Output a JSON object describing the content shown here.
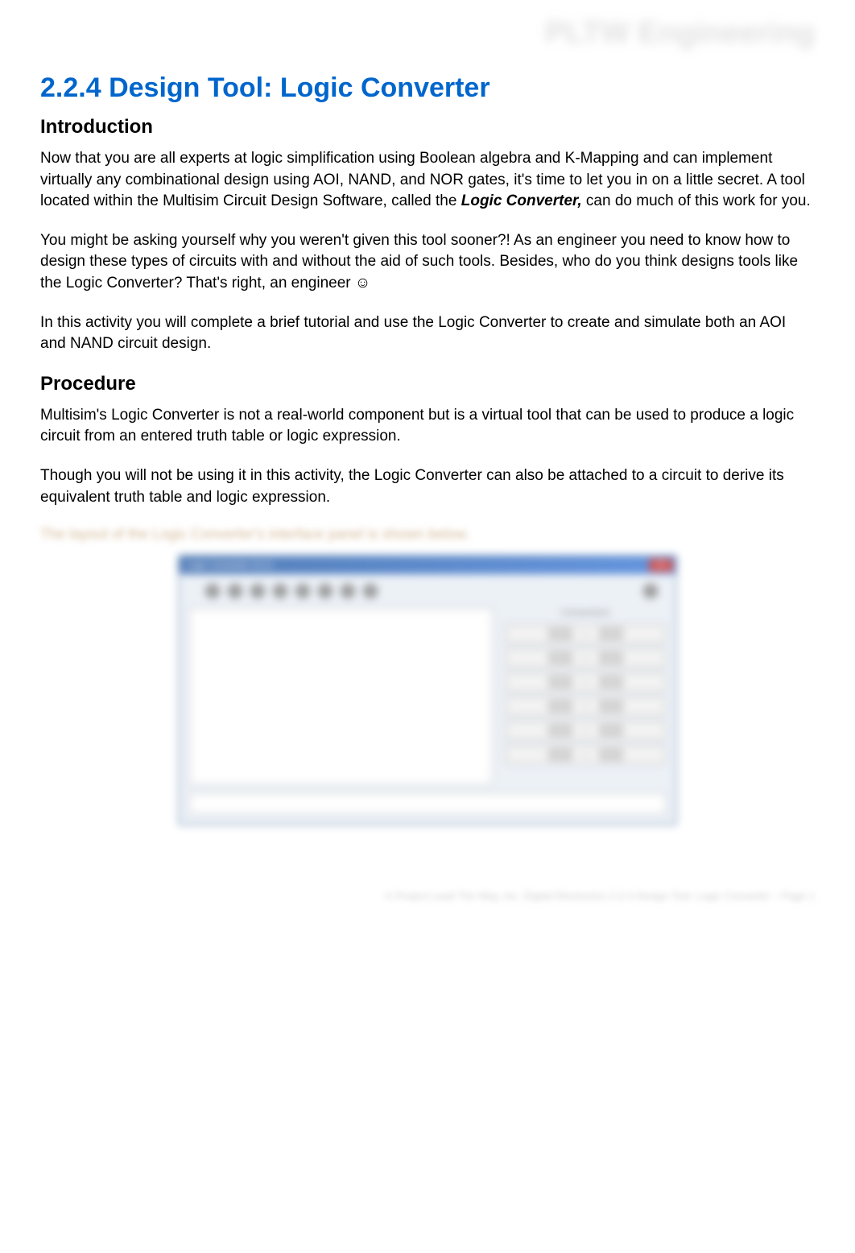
{
  "watermark": "PLTW Engineering",
  "page_title": "2.2.4 Design Tool: Logic Converter",
  "introduction": {
    "heading": "Introduction",
    "p1_a": "Now that you are all experts at logic simplification using Boolean algebra and K-Mapping and can implement virtually any combinational design using AOI, NAND, and NOR gates, it's time to let you in on a little secret. A tool located within the Multisim Circuit Design Software, called the ",
    "p1_b": "Logic Converter,",
    "p1_c": " can do much of this work for you.",
    "p2": "You might be asking yourself why you weren't given this tool sooner?! As an engineer you need to know how to design these types of circuits with and without the aid of such tools. Besides, who do you think designs tools like the Logic Converter? That's right, an engineer ☺",
    "p3": "In this activity you will complete a brief tutorial and use the Logic Converter to create and simulate both an AOI and NAND circuit design."
  },
  "procedure": {
    "heading": "Procedure",
    "p1": "Multisim's Logic Converter is not a real-world component but is a virtual tool that can be used to produce a logic circuit from an entered truth table or logic expression.",
    "p2": "Though you will not be using it in this activity, the Logic Converter can also be attached to a circuit to derive its equivalent truth table and logic expression.",
    "caption": "The layout of the Logic Converter's interface panel is shown below."
  },
  "screenshot": {
    "titlebar": "Logic Converter-XLC1",
    "close": "X",
    "conversions_label": "Conversions"
  },
  "footer": "© Project Lead The Way, Inc.  Digital Electronics  2.2.4 Design Tool: Logic Converter – Page 1"
}
